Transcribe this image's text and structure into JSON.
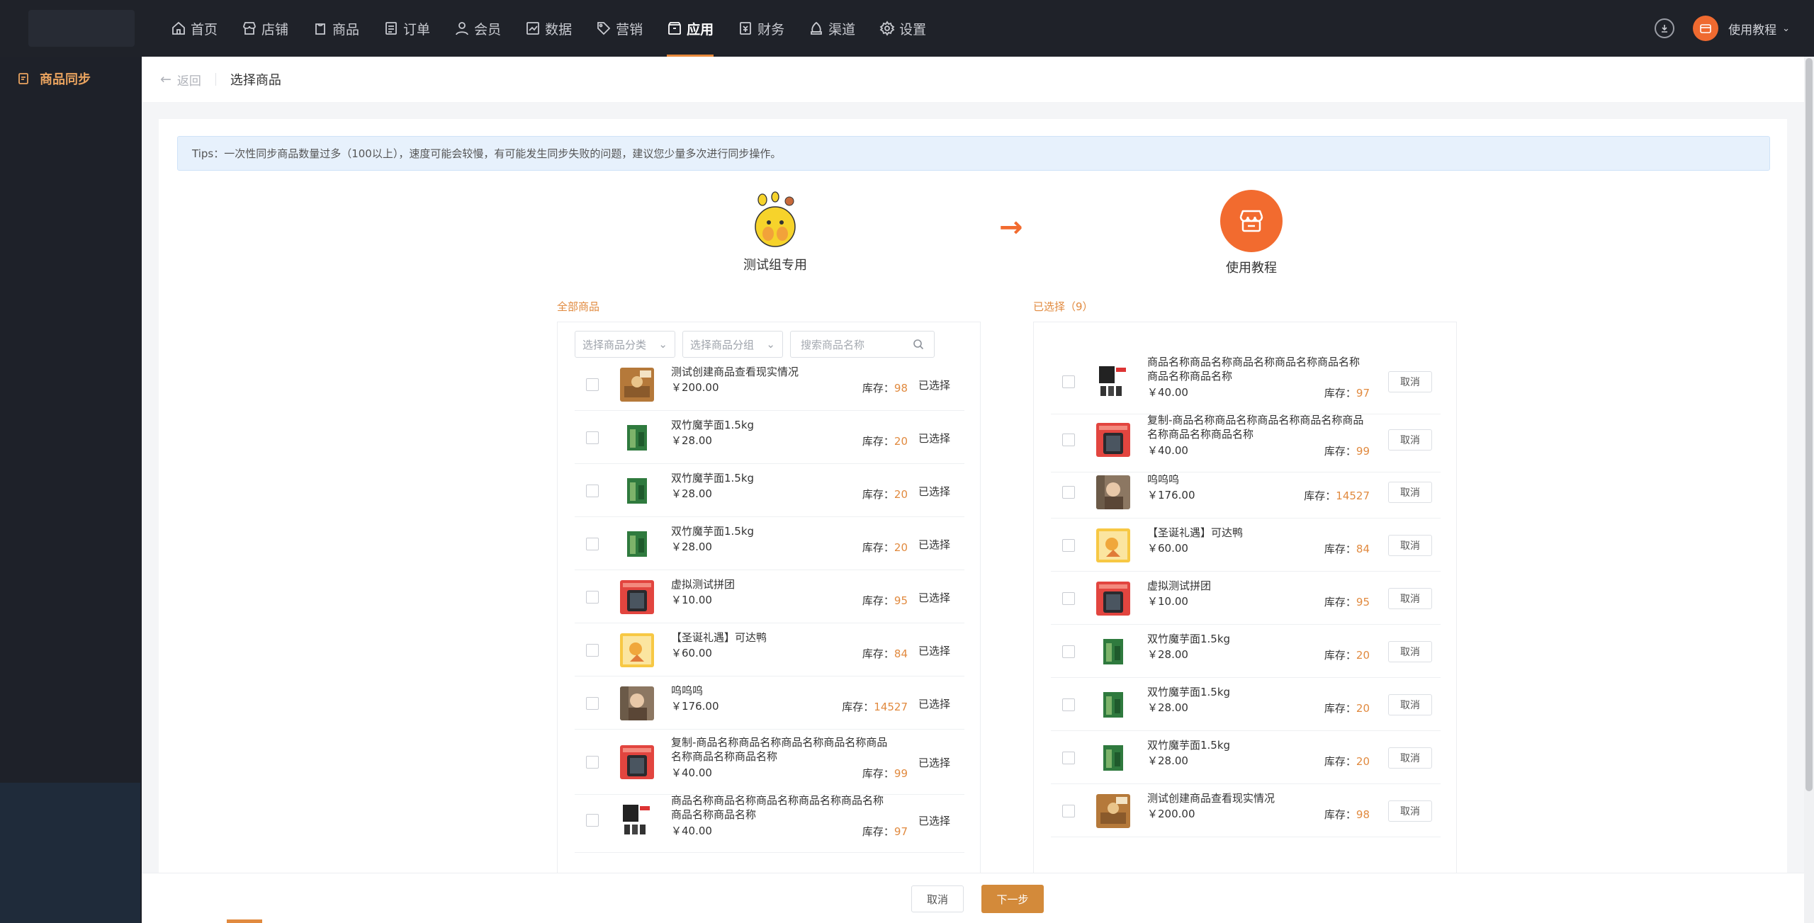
{
  "nav": {
    "items": [
      {
        "label": "首页",
        "icon": "home-icon",
        "active": false
      },
      {
        "label": "店铺",
        "icon": "store-icon",
        "active": false
      },
      {
        "label": "商品",
        "icon": "goods-icon",
        "active": false
      },
      {
        "label": "订单",
        "icon": "order-icon",
        "active": false
      },
      {
        "label": "会员",
        "icon": "member-icon",
        "active": false
      },
      {
        "label": "数据",
        "icon": "chart-icon",
        "active": false
      },
      {
        "label": "营销",
        "icon": "tag-icon",
        "active": false
      },
      {
        "label": "应用",
        "icon": "app-icon",
        "active": true
      },
      {
        "label": "财务",
        "icon": "finance-icon",
        "active": false
      },
      {
        "label": "渠道",
        "icon": "channel-icon",
        "active": false
      },
      {
        "label": "设置",
        "icon": "gear-icon",
        "active": false
      }
    ],
    "user_label": "使用教程"
  },
  "sidebar": {
    "item_label": "商品同步"
  },
  "header": {
    "back_label": "返回",
    "title": "选择商品"
  },
  "tips": "Tips：一次性同步商品数量过多（100以上），速度可能会较慢，有可能发生同步失败的问题，建议您少量多次进行同步操作。",
  "source_store": {
    "name": "测试组专用"
  },
  "target_store": {
    "name": "使用教程"
  },
  "left": {
    "section_label": "全部商品",
    "category_placeholder": "选择商品分类",
    "group_placeholder": "选择商品分组",
    "search_placeholder": "搜索商品名称",
    "stock_prefix": "库存：",
    "rows": [
      {
        "name": "测试创建商品查看现实情况",
        "price": "￥200.00",
        "stock": "98",
        "status": "已选择",
        "thumb": "cake"
      },
      {
        "name": "双竹魔芋面1.5kg",
        "price": "￥28.00",
        "stock": "20",
        "status": "已选择",
        "thumb": "green"
      },
      {
        "name": "双竹魔芋面1.5kg",
        "price": "￥28.00",
        "stock": "20",
        "status": "已选择",
        "thumb": "green"
      },
      {
        "name": "双竹魔芋面1.5kg",
        "price": "￥28.00",
        "stock": "20",
        "status": "已选择",
        "thumb": "green"
      },
      {
        "name": "虚拟测试拼团",
        "price": "￥10.00",
        "stock": "95",
        "status": "已选择",
        "thumb": "red"
      },
      {
        "name": "【圣诞礼遇】可达鸭",
        "price": "￥60.00",
        "stock": "84",
        "status": "已选择",
        "thumb": "yellow"
      },
      {
        "name": "呜呜呜",
        "price": "￥176.00",
        "stock": "14527",
        "status": "已选择",
        "thumb": "photo"
      },
      {
        "name": "复制-商品名称商品名称商品名称商品名称商品名称商品名称商品名称",
        "price": "￥40.00",
        "stock": "99",
        "status": "已选择",
        "thumb": "red"
      },
      {
        "name": "商品名称商品名称商品名称商品名称商品名称商品名称商品名称",
        "price": "￥40.00",
        "stock": "97",
        "status": "已选择",
        "thumb": "phone"
      }
    ]
  },
  "right": {
    "section_label": "已选择（9）",
    "stock_prefix": "库存：",
    "cancel_label": "取消",
    "rows": [
      {
        "name": "商品名称商品名称商品名称商品名称商品名称商品名称商品名称",
        "price": "￥40.00",
        "stock": "97",
        "thumb": "phone"
      },
      {
        "name": "复制-商品名称商品名称商品名称商品名称商品名称商品名称商品名称",
        "price": "￥40.00",
        "stock": "99",
        "thumb": "red"
      },
      {
        "name": "呜呜呜",
        "price": "￥176.00",
        "stock": "14527",
        "thumb": "photo"
      },
      {
        "name": "【圣诞礼遇】可达鸭",
        "price": "￥60.00",
        "stock": "84",
        "thumb": "yellow"
      },
      {
        "name": "虚拟测试拼团",
        "price": "￥10.00",
        "stock": "95",
        "thumb": "red"
      },
      {
        "name": "双竹魔芋面1.5kg",
        "price": "￥28.00",
        "stock": "20",
        "thumb": "green"
      },
      {
        "name": "双竹魔芋面1.5kg",
        "price": "￥28.00",
        "stock": "20",
        "thumb": "green"
      },
      {
        "name": "双竹魔芋面1.5kg",
        "price": "￥28.00",
        "stock": "20",
        "thumb": "green"
      },
      {
        "name": "测试创建商品查看现实情况",
        "price": "￥200.00",
        "stock": "98",
        "thumb": "cake"
      }
    ]
  },
  "footer": {
    "cancel_label": "取消",
    "next_label": "下一步"
  },
  "colors": {
    "accent": "#e18a3f",
    "brand": "#f26b2f",
    "nav_bg": "#1f2229",
    "next_button": "#d38a3a"
  }
}
